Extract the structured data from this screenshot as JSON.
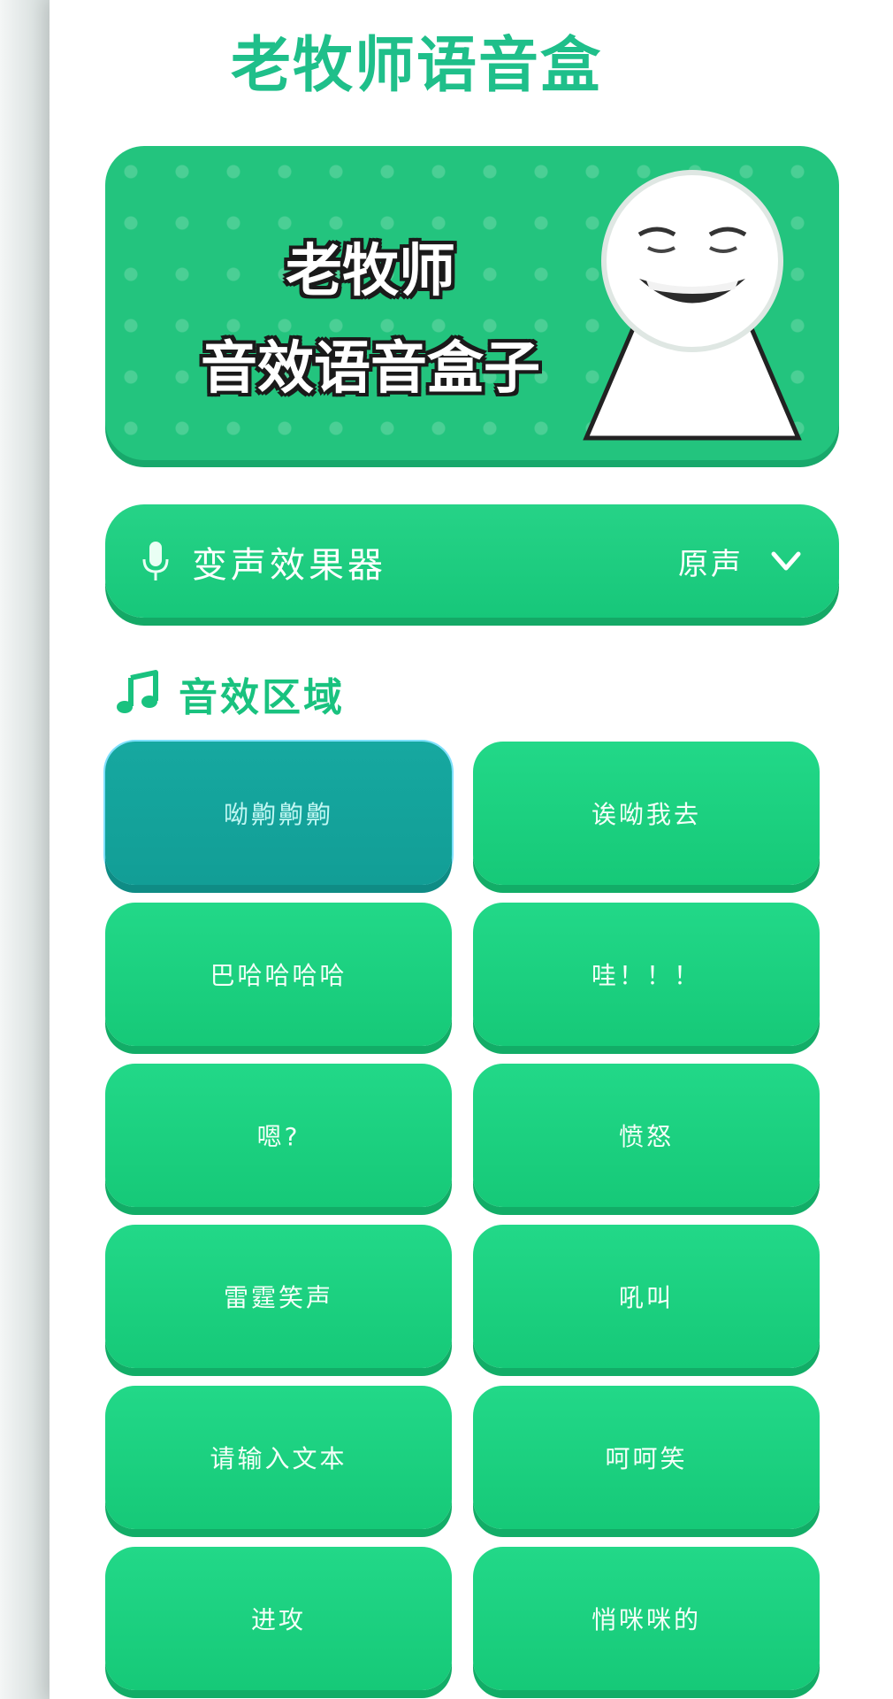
{
  "app": {
    "title": "老牧师语音盒"
  },
  "banner": {
    "line1": "老牧师",
    "line2": "音效语音盒子"
  },
  "voice_changer": {
    "label": "变声效果器",
    "value": "原声"
  },
  "section": {
    "title": "音效区域"
  },
  "sounds": [
    {
      "label": "呦齁齁齁",
      "active": true
    },
    {
      "label": "诶呦我去",
      "active": false
    },
    {
      "label": "巴哈哈哈哈",
      "active": false
    },
    {
      "label": "哇！！！",
      "active": false
    },
    {
      "label": "嗯?",
      "active": false
    },
    {
      "label": "愤怒",
      "active": false
    },
    {
      "label": "雷霆笑声",
      "active": false
    },
    {
      "label": "吼叫",
      "active": false
    },
    {
      "label": "请输入文本",
      "active": false
    },
    {
      "label": "呵呵笑",
      "active": false
    },
    {
      "label": "进攻",
      "active": false
    },
    {
      "label": "悄咪咪的",
      "active": false
    }
  ],
  "colors": {
    "accent": "#1fbf8a",
    "button": "#1ccf80",
    "active_button": "#14a59d"
  }
}
